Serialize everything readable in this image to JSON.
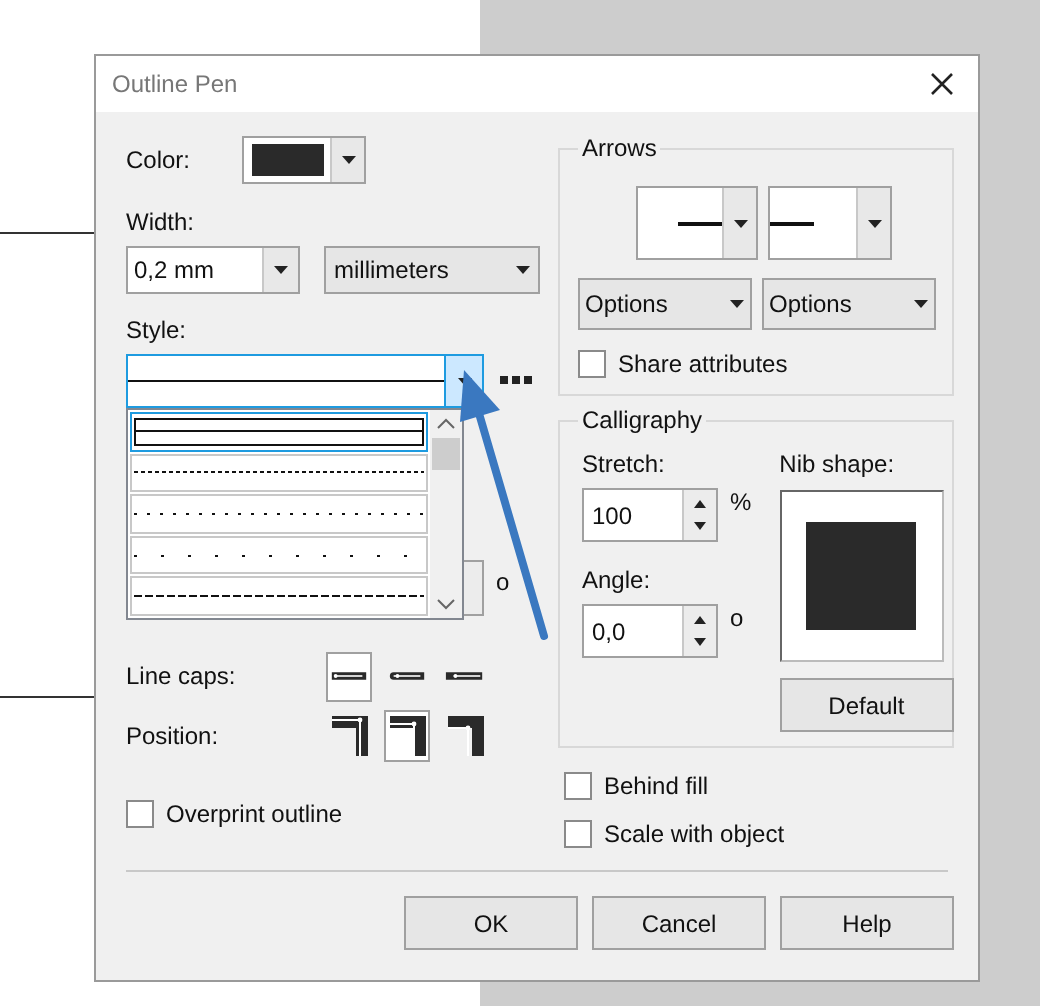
{
  "window": {
    "title": "Outline Pen"
  },
  "color": {
    "label": "Color:",
    "color": "#2a2a2a"
  },
  "width": {
    "label": "Width:",
    "value": "0,2 mm",
    "units": "millimeters"
  },
  "style": {
    "label": "Style:",
    "list_open": true,
    "options": [
      {
        "kind": "solid",
        "selected": true
      },
      {
        "kind": "fine-dash",
        "selected": false
      },
      {
        "kind": "dot",
        "selected": false
      },
      {
        "kind": "spaced-dot",
        "selected": false
      },
      {
        "kind": "dash",
        "selected": false
      }
    ]
  },
  "hidden_spinner": {
    "unit": "o"
  },
  "line_caps": {
    "label": "Line caps:",
    "options": [
      {
        "kind": "butt",
        "selected": true
      },
      {
        "kind": "round",
        "selected": false
      },
      {
        "kind": "square",
        "selected": false
      }
    ]
  },
  "position": {
    "label": "Position:",
    "options": [
      {
        "kind": "outside",
        "selected": false
      },
      {
        "kind": "center",
        "selected": true
      },
      {
        "kind": "inside",
        "selected": false
      }
    ]
  },
  "overprint": {
    "label": "Overprint outline",
    "checked": false
  },
  "arrows": {
    "title": "Arrows",
    "options_buttons": [
      "Options",
      "Options"
    ],
    "share": {
      "label": "Share attributes",
      "checked": false
    }
  },
  "calligraphy": {
    "title": "Calligraphy",
    "stretch": {
      "label": "Stretch:",
      "value": "100",
      "unit": "%"
    },
    "angle": {
      "label": "Angle:",
      "value": "0,0",
      "unit": "o"
    },
    "nib_label": "Nib shape:",
    "default_button": "Default"
  },
  "behind_fill": {
    "label": "Behind fill",
    "checked": false
  },
  "scale_with_object": {
    "label": "Scale with object",
    "checked": false
  },
  "buttons": [
    "OK",
    "Cancel",
    "Help"
  ]
}
